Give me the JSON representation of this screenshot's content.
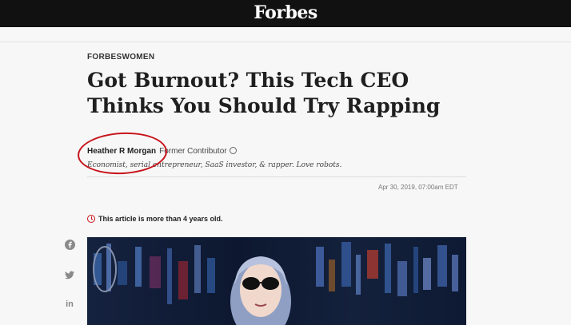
{
  "header": {
    "logo": "Forbes"
  },
  "article": {
    "section": "FORBESWOMEN",
    "headline": "Got Burnout? This Tech CEO Thinks You Should Try Rapping",
    "author": "Heather R Morgan",
    "author_role": "Former Contributor",
    "bio": "Economist, serial entrepreneur, SaaS investor, & rapper. Love robots.",
    "date": "Apr 30, 2019, 07:00am EDT",
    "age_notice": "This article is more than 4 years old."
  },
  "social": {
    "linkedin_glyph": "in"
  },
  "icons": [
    "info-icon",
    "clock-icon",
    "facebook-icon",
    "twitter-icon",
    "linkedin-icon"
  ],
  "colors": {
    "topbar": "#111111",
    "highlight_circle": "#c8131b",
    "notice_icon": "#c8131b"
  }
}
